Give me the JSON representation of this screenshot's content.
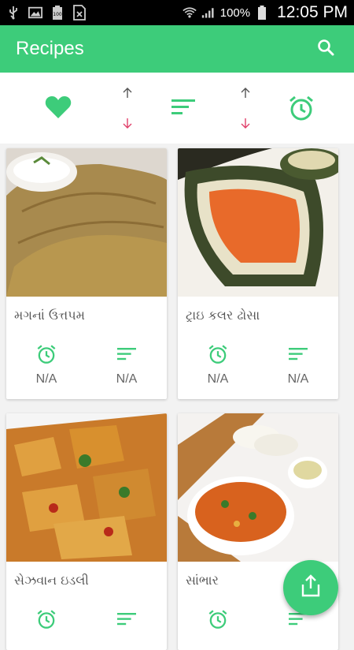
{
  "status_bar": {
    "battery_level": "100",
    "battery_percent": "100%",
    "time": "12:05 PM",
    "icons": [
      "usb-icon",
      "image-icon",
      "battery-small-icon",
      "no-sim-icon",
      "wifi-icon",
      "signal-icon",
      "battery-icon"
    ]
  },
  "app_bar": {
    "title": "Recipes",
    "search_icon": "search-icon"
  },
  "filter_bar": {
    "favorite_icon": "heart-icon",
    "sort_icon_1": "up-down-arrows-icon",
    "lines_icon": "sort-lines-icon",
    "sort_icon_2": "up-down-arrows-icon",
    "alarm_icon": "alarm-clock-icon"
  },
  "recipes": [
    {
      "title": "મગનાં ઉત્તપમ",
      "time": "N/A",
      "serves": "N/A"
    },
    {
      "title": "ટ્રાઇ કલર ઢોસા",
      "time": "N/A",
      "serves": "N/A"
    },
    {
      "title": "સેઝવાન ઇડલી",
      "time": "",
      "serves": ""
    },
    {
      "title": "સાંભાર",
      "time": "",
      "serves": ""
    }
  ],
  "fab": {
    "icon": "share-icon"
  },
  "colors": {
    "accent": "#3dcc7a",
    "arrow_down": "#e0406a",
    "arrow_up": "#555555"
  }
}
